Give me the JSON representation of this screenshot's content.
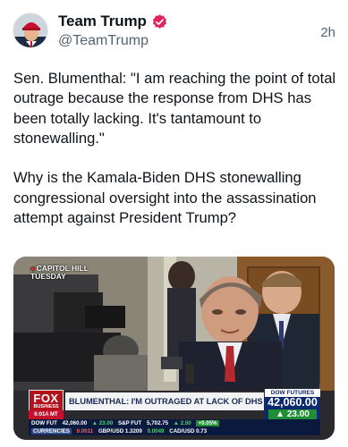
{
  "tweet": {
    "display_name": "Team Trump",
    "handle": "@TeamTrump",
    "timestamp": "2h",
    "verified_icon": "verified-badge-icon",
    "text": "Sen. Blumenthal: \"I am reaching the point of total outrage because the response from DHS has been totally lacking. It's tantamount to stonewalling.\"\n\nWhy is the Kamala-Biden DHS stonewalling congressional oversight into the assassination attempt against President Trump?"
  },
  "media": {
    "bug_line1": "CAPITOL HILL",
    "bug_line2": "TUESDAY",
    "network_logo": "FOX",
    "network_sub": "BUSINESS",
    "time_chip": "6:01A MT",
    "headline": "BLUMENTHAL: I'M OUTRAGED AT LACK OF DHS RESPONSE",
    "dow_label": "DOW FUTURES",
    "dow_value": "42,060.00",
    "dow_change": "▲ 23.00",
    "ticker": {
      "dow_label": "DOW FUT",
      "dow_value": "42,060.00",
      "dow_change": "▲ 23.00",
      "sp_label": "S&P FUT",
      "sp_value": "5,702.75",
      "sp_change": "▲ 2.50",
      "right_change": "+0.05%",
      "currencies_label": "CURRENCIES",
      "c1_value": "0.0011",
      "c2": "GBP/USD 1.3209",
      "c3_value": "0.0049",
      "c4": "CAD/USD 0.73"
    },
    "colors": {
      "fox_red": "#b3121d",
      "navy": "#0b2a6f",
      "up_green": "#1f8f36"
    }
  }
}
